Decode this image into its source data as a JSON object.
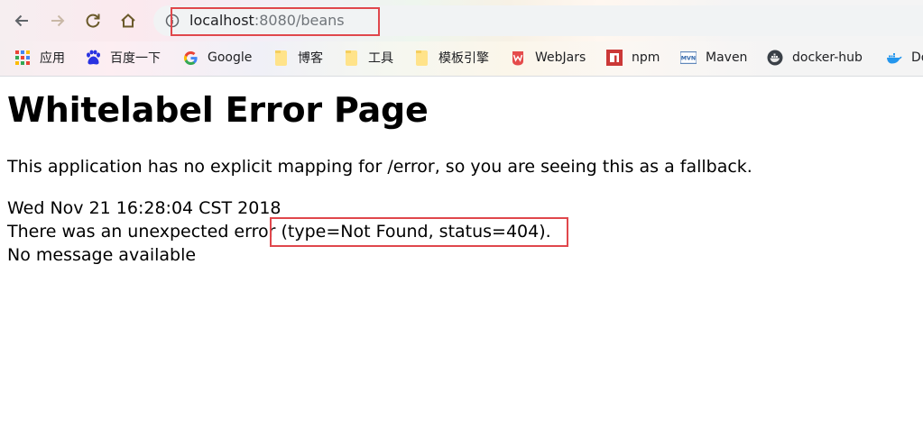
{
  "browser": {
    "nav": {
      "back_icon": "arrow-left-icon",
      "forward_icon": "arrow-right-icon",
      "reload_icon": "reload-icon",
      "home_icon": "home-icon"
    },
    "address_bar": {
      "info_icon": "info-circle-icon",
      "url_host": "localhost",
      "url_rest": ":8080/beans",
      "highlight_color": "#e0474c"
    },
    "bookmarks": [
      {
        "label": "应用",
        "icon": "apps-grid-icon"
      },
      {
        "label": "百度一下",
        "icon": "baidu-paw-icon"
      },
      {
        "label": "Google",
        "icon": "google-g-icon"
      },
      {
        "label": "博客",
        "icon": "folder-icon"
      },
      {
        "label": "工具",
        "icon": "folder-icon"
      },
      {
        "label": "模板引擎",
        "icon": "folder-icon"
      },
      {
        "label": "WebJars",
        "icon": "webjars-icon"
      },
      {
        "label": "npm",
        "icon": "npm-icon"
      },
      {
        "label": "Maven",
        "icon": "maven-icon"
      },
      {
        "label": "docker-hub",
        "icon": "docker-hub-icon"
      },
      {
        "label": "Do",
        "icon": "docker-whale-icon"
      }
    ]
  },
  "page": {
    "title": "Whitelabel Error Page",
    "description": "This application has no explicit mapping for /error, so you are seeing this as a fallback.",
    "timestamp": "Wed Nov 21 16:28:04 CST 2018",
    "error_prefix": "There was an unexpected error ",
    "error_detail": "(type=Not Found, status=404).",
    "message": "No message available",
    "highlight_color": "#e0474c"
  }
}
